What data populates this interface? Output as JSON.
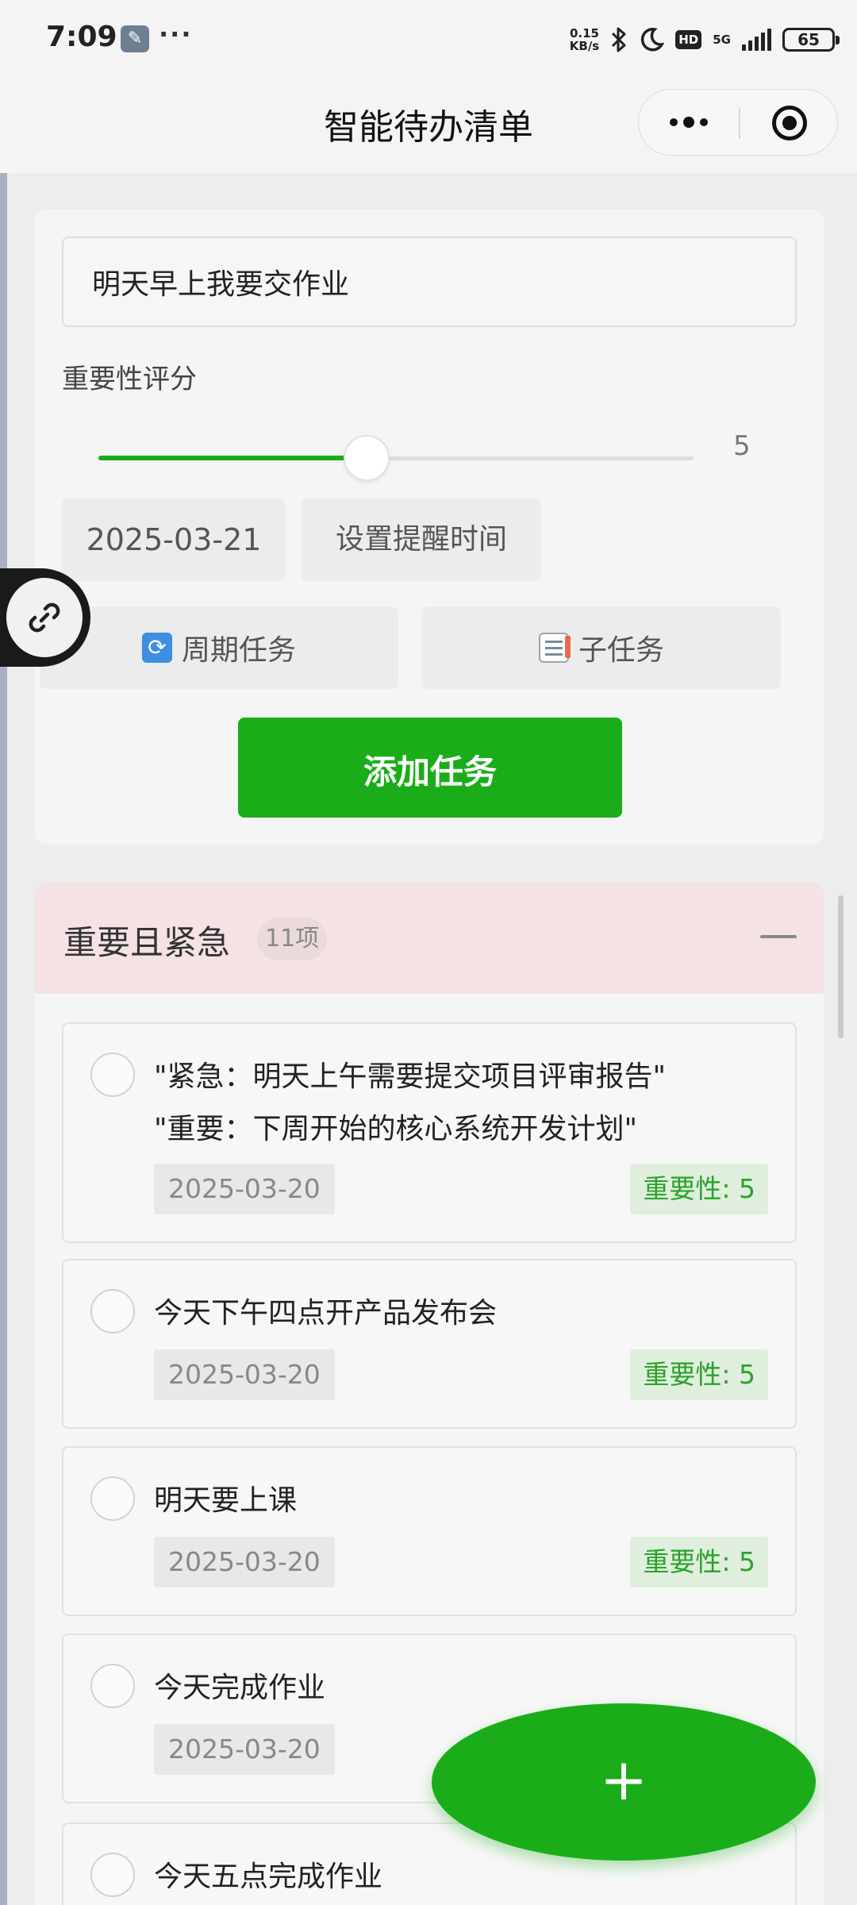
{
  "status_bar": {
    "time": "7:09",
    "more": "···",
    "net_speed_value": "0.15",
    "net_speed_unit": "KB/s",
    "network": "5G",
    "hd": "HD",
    "battery": "65"
  },
  "header": {
    "title": "智能待办清单"
  },
  "form": {
    "task_input_value": "明天早上我要交作业",
    "importance_label": "重要性评分",
    "importance_value": "5",
    "importance_fraction": 0.45,
    "date": "2025-03-21",
    "remind_label": "设置提醒时间",
    "periodic_label": "周期任务",
    "subtask_label": "子任务",
    "add_label": "添加任务"
  },
  "section": {
    "title": "重要且紧急",
    "count": "11项"
  },
  "tasks": [
    {
      "text": "\"紧急：明天上午需要提交项目评审报告\"\n\"重要：下周开始的核心系统开发计划\"",
      "date": "2025-03-20",
      "importance": "重要性: 5"
    },
    {
      "text": "今天下午四点开产品发布会",
      "date": "2025-03-20",
      "importance": "重要性: 5"
    },
    {
      "text": "明天要上课",
      "date": "2025-03-20",
      "importance": "重要性: 5"
    },
    {
      "text": "今天完成作业",
      "date": "2025-03-20",
      "importance": ""
    },
    {
      "text": "今天五点完成作业",
      "date": "",
      "importance": ""
    }
  ],
  "fab": {
    "label": "+"
  },
  "colors": {
    "accent": "#1aad19",
    "section_bg": "#f5e2e4",
    "importance_tag": "#2aa32a"
  }
}
